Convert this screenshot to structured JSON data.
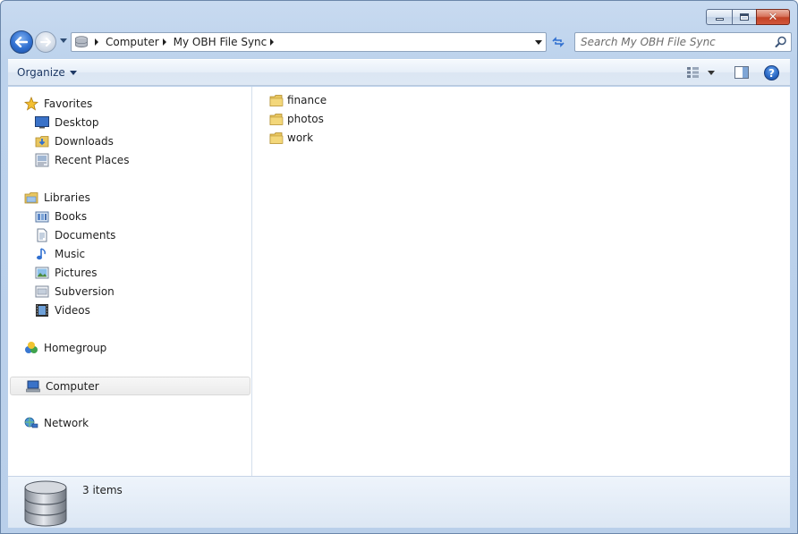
{
  "window": {
    "caption_buttons": {
      "minimize": "minimize",
      "maximize": "maximize",
      "close": "close"
    }
  },
  "navigation": {
    "breadcrumbs": [
      "Computer",
      "My OBH File Sync"
    ],
    "search_placeholder": "Search My OBH File Sync"
  },
  "command_bar": {
    "organize_label": "Organize"
  },
  "nav_pane": {
    "favorites": {
      "label": "Favorites",
      "items": [
        {
          "label": "Desktop",
          "icon": "desktop-icon"
        },
        {
          "label": "Downloads",
          "icon": "downloads-icon"
        },
        {
          "label": "Recent Places",
          "icon": "recent-places-icon"
        }
      ]
    },
    "libraries": {
      "label": "Libraries",
      "items": [
        {
          "label": "Books",
          "icon": "books-icon"
        },
        {
          "label": "Documents",
          "icon": "documents-icon"
        },
        {
          "label": "Music",
          "icon": "music-icon"
        },
        {
          "label": "Pictures",
          "icon": "pictures-icon"
        },
        {
          "label": "Subversion",
          "icon": "subversion-icon"
        },
        {
          "label": "Videos",
          "icon": "videos-icon"
        }
      ]
    },
    "homegroup": {
      "label": "Homegroup"
    },
    "computer": {
      "label": "Computer",
      "selected": true
    },
    "network": {
      "label": "Network"
    }
  },
  "files": [
    {
      "name": "finance",
      "type": "folder"
    },
    {
      "name": "photos",
      "type": "folder"
    },
    {
      "name": "work",
      "type": "folder"
    }
  ],
  "details": {
    "item_count": "3 items"
  },
  "colors": {
    "frame": "#b9cfea",
    "accent": "#2f6fd0",
    "folder": "#e8c660",
    "selection": "#ebebeb"
  }
}
